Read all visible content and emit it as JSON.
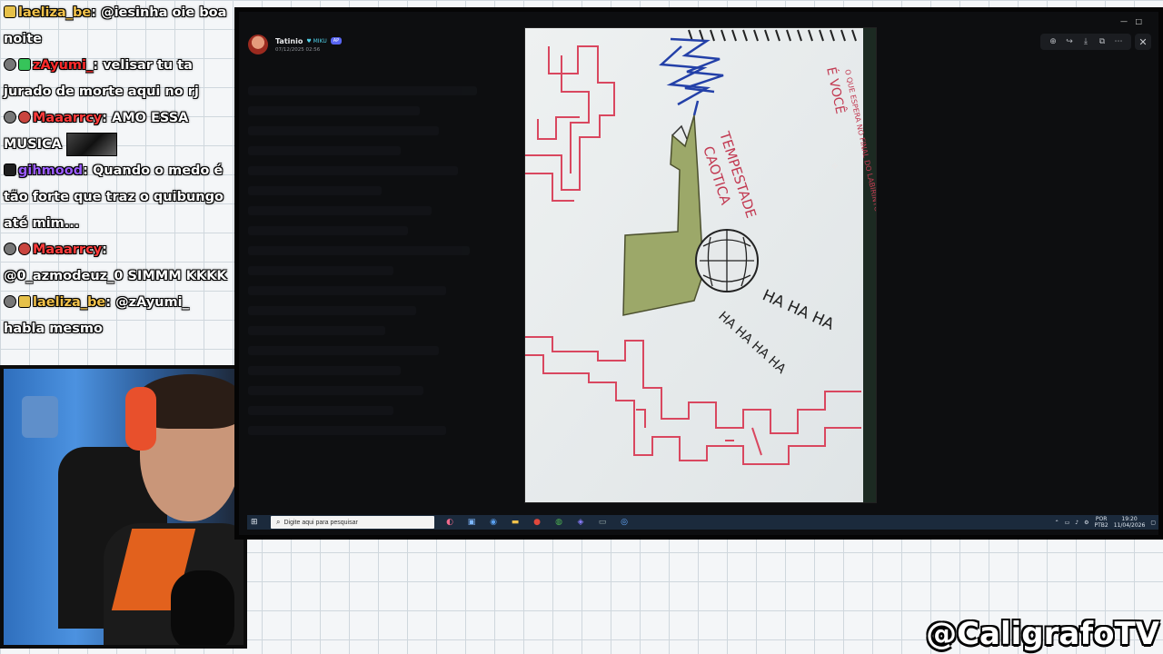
{
  "chat": {
    "messages": [
      {
        "user": "laeliza_be",
        "badge": "yellow",
        "color": "#f2c24b",
        "text": ": @iesinha oie boa noite"
      },
      {
        "user": "zAyumi_",
        "badge": "green",
        "color": "#ff2a2a",
        "text": ": velisar tu ta jurado de morte aqui no rj"
      },
      {
        "user": "Maaarrcy",
        "badge": "red",
        "color": "#ff3b3b",
        "text": ": AMO ESSA MUSICA"
      },
      {
        "user": "gihmood",
        "badge": "purple",
        "color": "#9b5cff",
        "text": ": Quando o medo é tão forte que traz o quibungo até mim..."
      },
      {
        "user": "Maaarrcy",
        "badge": "red",
        "color": "#ff3b3b",
        "text": ": @0_azmodeuz_0 SIMMM KKKK"
      },
      {
        "user": "laeliza_be",
        "badge": "yellow",
        "color": "#f2c24b",
        "text": ": @zAyumi_ habla mesmo"
      }
    ]
  },
  "viewer": {
    "author": "Tatinio",
    "role": "MIKU",
    "tag": "AP",
    "timestamp": "07/12/2025 02:56",
    "toolbar": {
      "zoom_icon": "zoom-in-icon",
      "forward_icon": "forward-icon",
      "download_icon": "download-icon",
      "open_icon": "open-external-icon",
      "more_icon": "more-icon",
      "close_icon": "close-icon"
    }
  },
  "drawing": {
    "title_line1": "TEMPESTADE",
    "title_line2": "CAOTICA",
    "side_line1": "O QUE ESPERA NO FINAL DO LABIRINTO É ALGO PARA MIM?",
    "side_line2": "É VOCÊ",
    "laugh1": "HA HA HA",
    "laugh2": "HA HA HA HA"
  },
  "taskbar": {
    "search_placeholder": "Digite aqui para pesquisar",
    "lang": "POR",
    "lang_sub": "PTB2",
    "time": "19:20",
    "date": "11/04/2026"
  },
  "brand": {
    "handle": "@CaligrafoTV"
  },
  "colors": {
    "accent_red": "#ff3b3b",
    "taskbar": "#1b2a3c",
    "discord_blurple": "#5865f2"
  }
}
